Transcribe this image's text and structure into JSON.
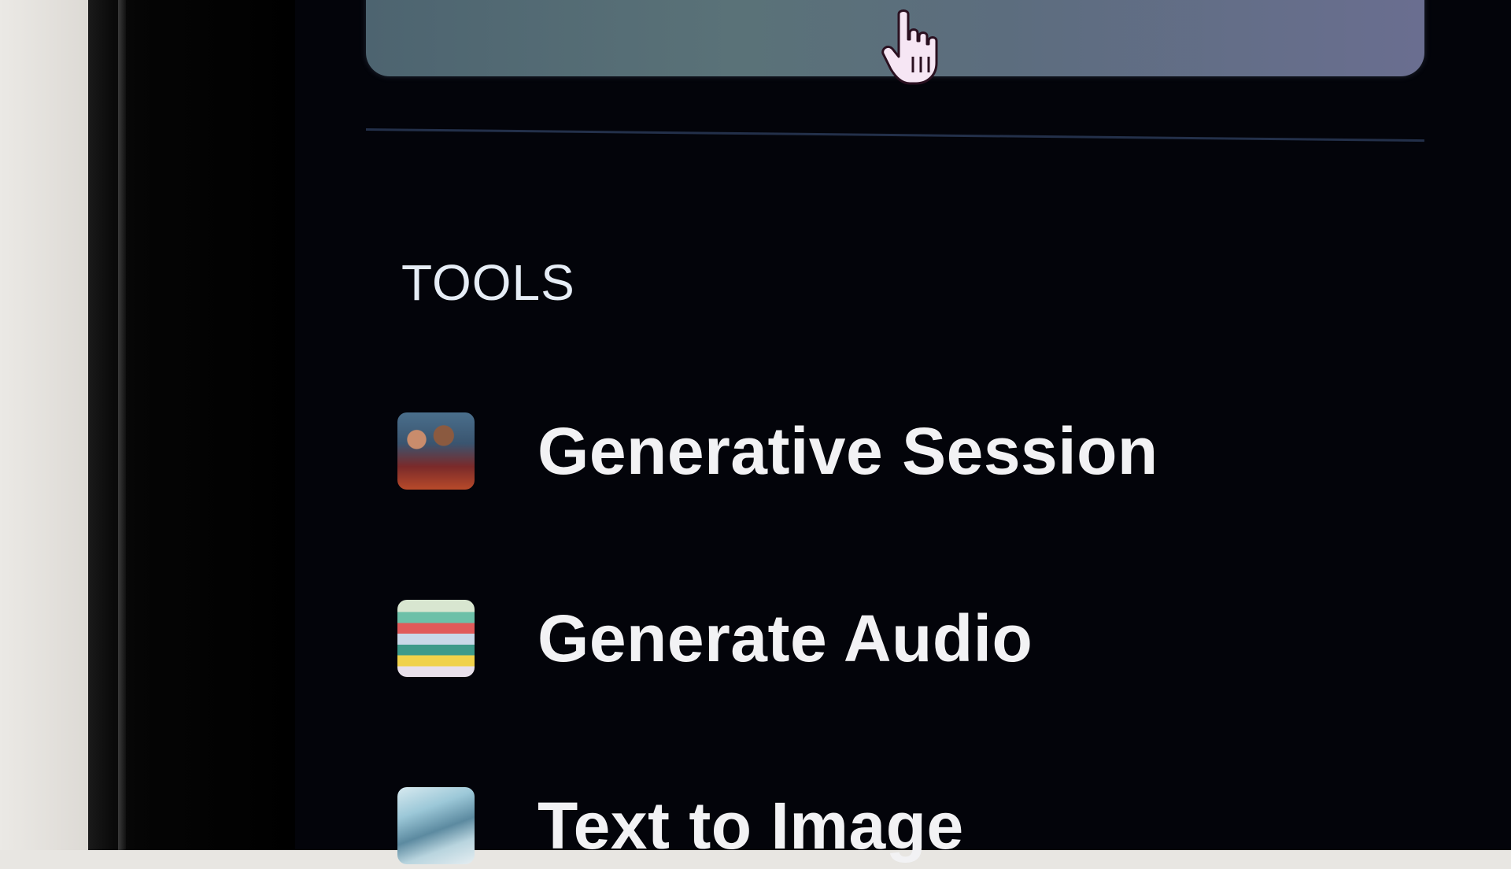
{
  "sidebar": {
    "section_title": "TOOLS",
    "tools": [
      {
        "label": "Generative Session",
        "icon": "generative-session-thumbnail"
      },
      {
        "label": "Generate Audio",
        "icon": "generate-audio-thumbnail"
      },
      {
        "label": "Text to Image",
        "icon": "text-to-image-thumbnail"
      }
    ]
  },
  "colors": {
    "background": "#03040a",
    "top_card_start": "#4d6470",
    "top_card_end": "#6a6e90",
    "text": "#f2f2f4",
    "divider": "#23304a"
  }
}
